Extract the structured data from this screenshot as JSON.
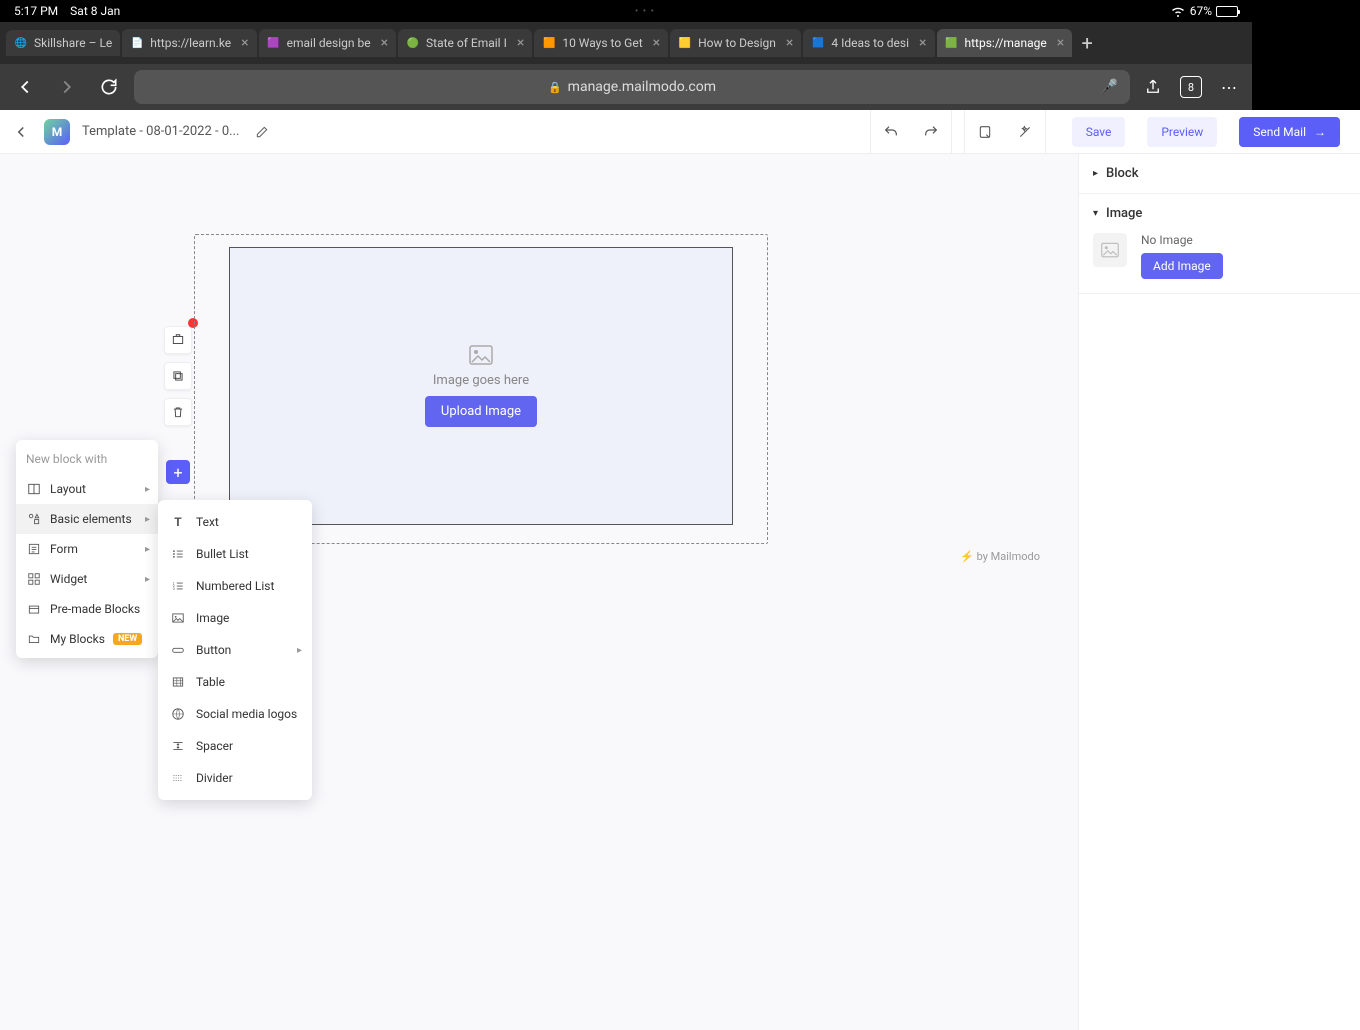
{
  "status": {
    "time": "5:17 PM",
    "date": "Sat 8 Jan",
    "battery": "67%"
  },
  "browser": {
    "tabs": [
      {
        "label": "Skillshare – Le"
      },
      {
        "label": "https://learn.ke"
      },
      {
        "label": "email design be"
      },
      {
        "label": "State of Email I"
      },
      {
        "label": "10 Ways to Get"
      },
      {
        "label": "How to Design"
      },
      {
        "label": "4 Ideas to desi"
      },
      {
        "label": "https://manage"
      }
    ],
    "url": "manage.mailmodo.com",
    "tab_count": "8"
  },
  "header": {
    "template_name": "Template - 08-01-2022 - 0...",
    "save": "Save",
    "preview": "Preview",
    "send": "Send Mail"
  },
  "canvas": {
    "image_label": "Image goes here",
    "upload": "Upload Image",
    "footer": "by Mailmodo"
  },
  "menu1": {
    "title": "New block with",
    "items": [
      {
        "label": "Layout",
        "submenu": true
      },
      {
        "label": "Basic elements",
        "submenu": true
      },
      {
        "label": "Form",
        "submenu": true
      },
      {
        "label": "Widget",
        "submenu": true
      },
      {
        "label": "Pre-made Blocks",
        "submenu": false
      },
      {
        "label": "My Blocks",
        "submenu": false,
        "badge": "NEW"
      }
    ]
  },
  "menu2": {
    "items": [
      {
        "label": "Text"
      },
      {
        "label": "Bullet List"
      },
      {
        "label": "Numbered List"
      },
      {
        "label": "Image"
      },
      {
        "label": "Button",
        "submenu": true
      },
      {
        "label": "Table"
      },
      {
        "label": "Social media logos"
      },
      {
        "label": "Spacer"
      },
      {
        "label": "Divider"
      }
    ]
  },
  "right_panel": {
    "block": "Block",
    "image": "Image",
    "no_image": "No Image",
    "add_image": "Add Image"
  }
}
